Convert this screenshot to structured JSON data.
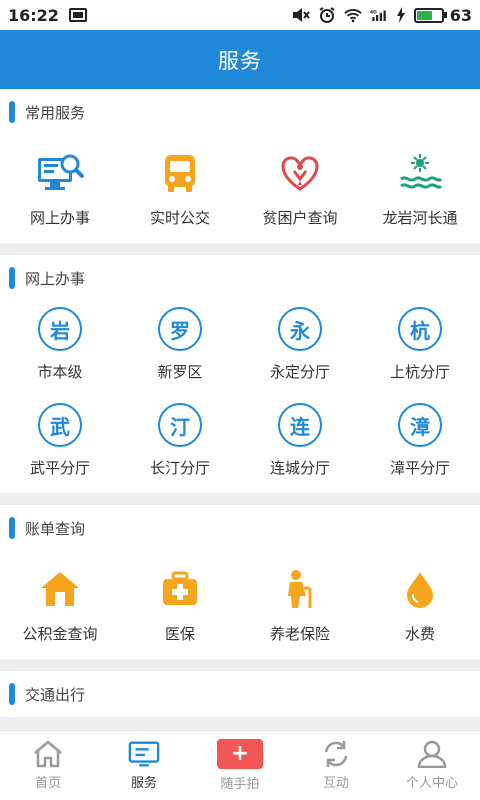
{
  "status_bar": {
    "time": "16:22",
    "battery": "63",
    "battery_level": 0.63,
    "signal_label": "4G"
  },
  "header": {
    "title": "服务"
  },
  "sections": [
    {
      "title": "常用服务",
      "items": [
        {
          "label": "网上办事",
          "icon": "computer-search-icon"
        },
        {
          "label": "实时公交",
          "icon": "bus-icon"
        },
        {
          "label": "贫困户查询",
          "icon": "poverty-heart-icon"
        },
        {
          "label": "龙岩河长通",
          "icon": "river-sun-icon"
        }
      ]
    },
    {
      "title": "网上办事",
      "items": [
        {
          "label": "市本级",
          "glyph": "岩"
        },
        {
          "label": "新罗区",
          "glyph": "罗"
        },
        {
          "label": "永定分厅",
          "glyph": "永"
        },
        {
          "label": "上杭分厅",
          "glyph": "杭"
        },
        {
          "label": "武平分厅",
          "glyph": "武"
        },
        {
          "label": "长汀分厅",
          "glyph": "汀"
        },
        {
          "label": "连城分厅",
          "glyph": "连"
        },
        {
          "label": "漳平分厅",
          "glyph": "漳"
        }
      ]
    },
    {
      "title": "账单查询",
      "items": [
        {
          "label": "公积金查询",
          "icon": "house-icon"
        },
        {
          "label": "医保",
          "icon": "medical-kit-icon"
        },
        {
          "label": "养老保险",
          "icon": "elderly-icon"
        },
        {
          "label": "水费",
          "icon": "water-drop-icon"
        }
      ]
    },
    {
      "title": "交通出行"
    }
  ],
  "bottom_nav": [
    {
      "label": "首页",
      "icon": "home-icon"
    },
    {
      "label": "服务",
      "icon": "service-icon",
      "active": true
    },
    {
      "label": "随手拍",
      "icon": "plus-icon",
      "symbol": "+"
    },
    {
      "label": "互动",
      "icon": "refresh-icon"
    },
    {
      "label": "个人中心",
      "icon": "user-icon"
    }
  ],
  "colors": {
    "primary": "#1f88d8",
    "accent_orange": "#f7a51c",
    "accent_red": "#f25757",
    "accent_green": "#1aa37a"
  }
}
